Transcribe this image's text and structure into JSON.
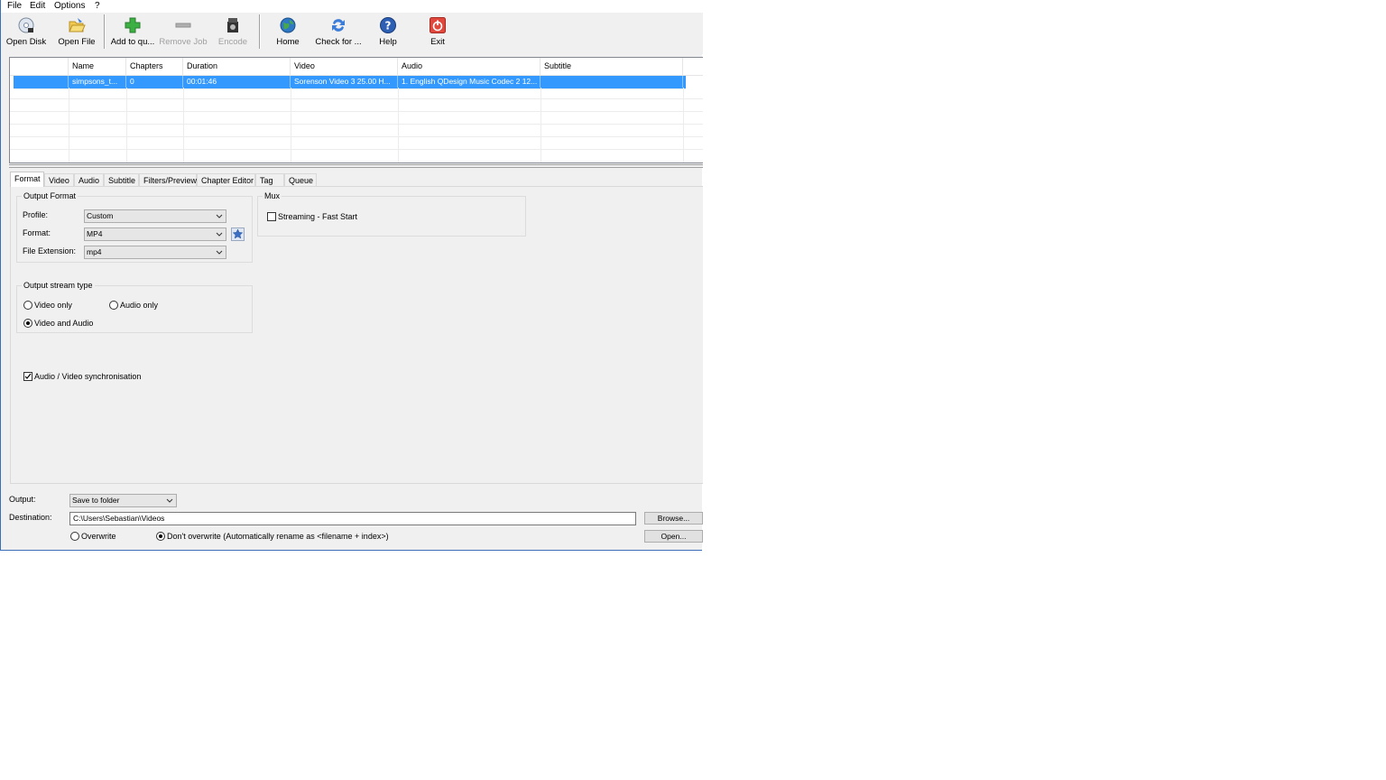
{
  "menu": [
    "File",
    "Edit",
    "Options",
    "?"
  ],
  "toolbar": {
    "open_disk": "Open Disk",
    "open_file": "Open File",
    "add_queue": "Add to qu...",
    "remove_job": "Remove Job",
    "encode": "Encode",
    "home": "Home",
    "check": "Check for ...",
    "help": "Help",
    "exit": "Exit"
  },
  "joblist": {
    "columns": [
      "",
      "Name",
      "Chapters",
      "Duration",
      "Video",
      "Audio",
      "Subtitle"
    ],
    "rows": [
      {
        "name": "simpsons_t...",
        "chapters": "0",
        "duration": "00:01:46",
        "video": "Sorenson Video 3 25.00 H...",
        "audio": "1. English QDesign Music Codec 2 12...",
        "subtitle": ""
      }
    ]
  },
  "tabs": [
    "Format",
    "Video",
    "Audio",
    "Subtitle",
    "Filters/Preview",
    "Chapter Editor",
    "Tag",
    "Queue"
  ],
  "format_tab": {
    "output_format_title": "Output Format",
    "profile_label": "Profile:",
    "profile_value": "Custom",
    "format_label": "Format:",
    "format_value": "MP4",
    "ext_label": "File Extension:",
    "ext_value": "mp4",
    "mux_title": "Mux",
    "streaming_label": "Streaming - Fast Start",
    "streaming_checked": false,
    "stream_type_title": "Output stream type",
    "video_only": "Video only",
    "audio_only": "Audio only",
    "video_and_audio": "Video and Audio",
    "stream_type_selected": "video_and_audio",
    "av_sync_label": "Audio / Video synchronisation",
    "av_sync_checked": true
  },
  "output": {
    "output_label": "Output:",
    "output_value": "Save to folder",
    "destination_label": "Destination:",
    "destination_value": "C:\\Users\\Sebastian\\Videos",
    "browse": "Browse...",
    "open": "Open...",
    "overwrite": "Overwrite",
    "dont_overwrite": "Don't overwrite (Automatically rename as <filename + index>)",
    "overwrite_selected": "dont_overwrite"
  },
  "colors": {
    "selection": "#3399ff",
    "window_bg": "#f0f0f0",
    "border_accent": "#3d6fb8"
  }
}
